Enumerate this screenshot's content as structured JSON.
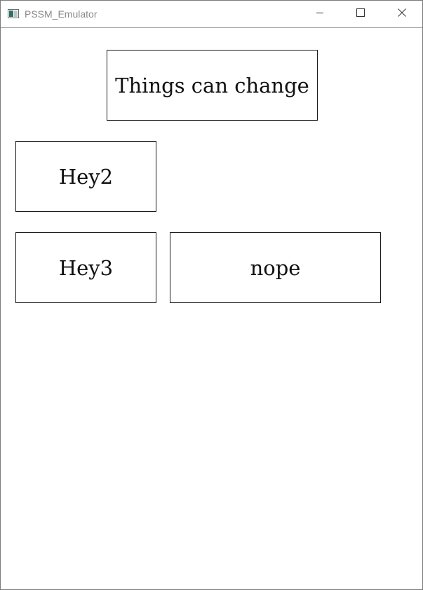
{
  "window": {
    "title": "PSSM_Emulator",
    "icons": {
      "app": "app-window-icon",
      "minimize": "minimize-icon",
      "maximize": "maximize-icon",
      "close": "close-icon"
    }
  },
  "buttons": {
    "main": "Things can change",
    "hey2": "Hey2",
    "hey3": "Hey3",
    "nope": "nope"
  }
}
